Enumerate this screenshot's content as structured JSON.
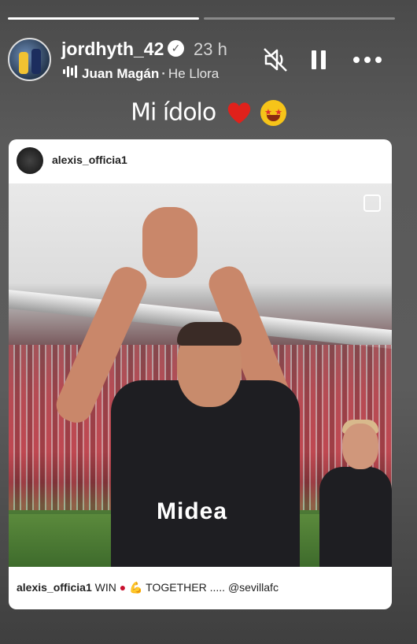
{
  "story": {
    "progress": [
      1.0,
      0.0
    ],
    "username": "jordhyth_42",
    "time": "23 h",
    "music": {
      "artist": "Juan Magán",
      "separator": "·",
      "title": "He Llora"
    },
    "caption_text": "Mi ídolo",
    "caption_emojis": [
      "red-heart",
      "star-struck"
    ]
  },
  "post": {
    "username": "alexis_officia1",
    "caption_user": "alexis_officia1",
    "caption_text_1": "WIN",
    "caption_text_2": "TOGETHER .....",
    "caption_mention": "@sevillafc",
    "sponsor_text": "Midea"
  }
}
